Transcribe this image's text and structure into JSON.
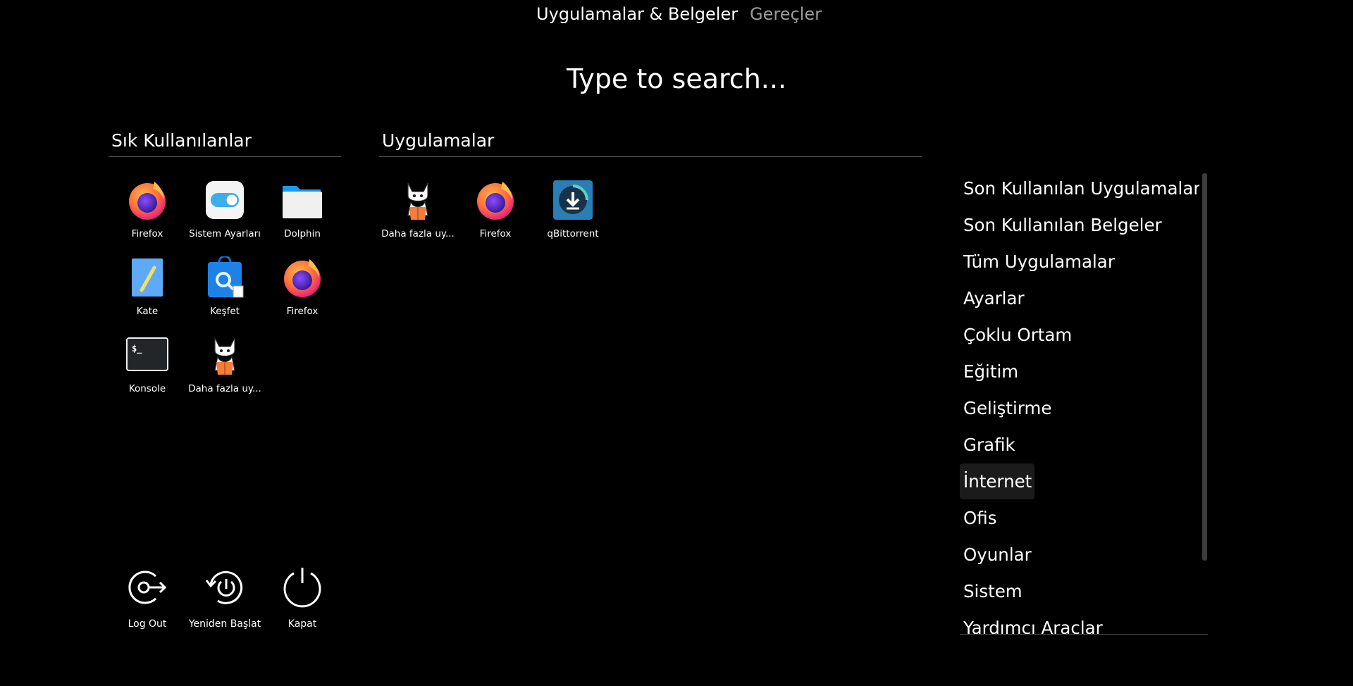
{
  "tabs": {
    "apps_label": "Uygulamalar & Belgeler",
    "tools_label": "Gereçler"
  },
  "search": {
    "placeholder": "Type to search..."
  },
  "favorites": {
    "title": "Sık Kullanılanlar",
    "items": [
      {
        "label": "Firefox",
        "icon": "firefox-icon"
      },
      {
        "label": "Sistem Ayarları",
        "icon": "system-settings-icon"
      },
      {
        "label": "Dolphin",
        "icon": "folder-icon"
      },
      {
        "label": "Kate",
        "icon": "kate-icon"
      },
      {
        "label": "Keşfet",
        "icon": "discover-icon"
      },
      {
        "label": "Firefox",
        "icon": "firefox-icon"
      },
      {
        "label": "Konsole",
        "icon": "terminal-icon"
      },
      {
        "label": "Daha fazla uy...",
        "icon": "cat-mascot-icon"
      }
    ]
  },
  "apps": {
    "title": "Uygulamalar",
    "items": [
      {
        "label": "Daha fazla uy...",
        "icon": "cat-mascot-icon"
      },
      {
        "label": "Firefox",
        "icon": "firefox-icon"
      },
      {
        "label": "qBittorrent",
        "icon": "qbittorrent-icon"
      }
    ]
  },
  "categories": {
    "items": [
      "Son Kullanılan Uygulamalar",
      "Son Kullanılan Belgeler",
      "Tüm Uygulamalar",
      "Ayarlar",
      "Çoklu Ortam",
      "Eğitim",
      "Geliştirme",
      "Grafik",
      "İnternet",
      "Ofis",
      "Oyunlar",
      "Sistem",
      "Yardımcı Araçlar"
    ],
    "selected": "İnternet"
  },
  "power": {
    "logout_label": "Log Out",
    "restart_label": "Yeniden Başlat",
    "shutdown_label": "Kapat"
  },
  "colors": {
    "background": "#000000",
    "text": "#ffffff",
    "inactive_tab": "#9a9a9a",
    "highlight": "#1b1b1b",
    "firefox_orange": "#ff7139",
    "firefox_purple": "#6e2bd9",
    "qbittorrent_blue": "#1d6e9c"
  }
}
